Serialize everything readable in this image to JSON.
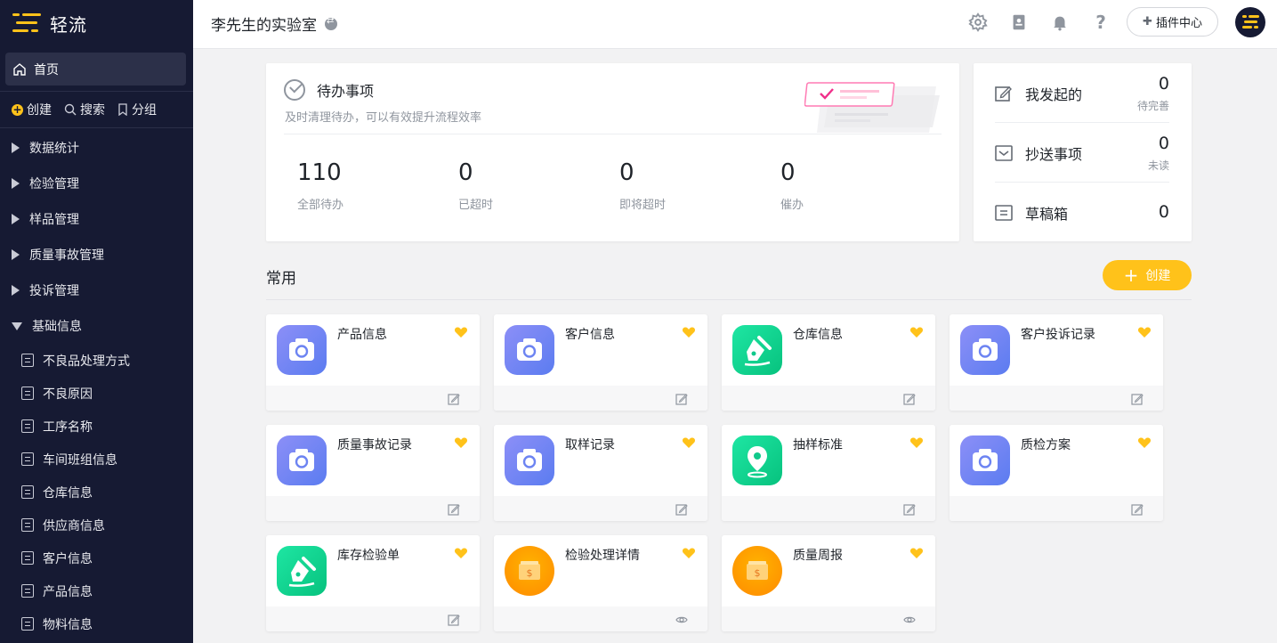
{
  "app": {
    "name": "轻流"
  },
  "sidebar": {
    "home_label": "首页",
    "quick": [
      {
        "label": "创建",
        "icon": "plus-circle-icon"
      },
      {
        "label": "搜索",
        "icon": "search-icon"
      },
      {
        "label": "分组",
        "icon": "bookmark-icon"
      }
    ],
    "groups": [
      {
        "label": "数据统计",
        "expanded": false
      },
      {
        "label": "检验管理",
        "expanded": false
      },
      {
        "label": "样品管理",
        "expanded": false
      },
      {
        "label": "质量事故管理",
        "expanded": false
      },
      {
        "label": "投诉管理",
        "expanded": false
      },
      {
        "label": "基础信息",
        "expanded": true
      }
    ],
    "sub_items": [
      "不良品处理方式",
      "不良原因",
      "工序名称",
      "车间班组信息",
      "仓库信息",
      "供应商信息",
      "客户信息",
      "产品信息",
      "物料信息"
    ]
  },
  "topbar": {
    "workspace": "李先生的实验室",
    "plugin_label": "插件中心",
    "icons": [
      "settings-icon",
      "contacts-icon",
      "bell-icon",
      "help-icon"
    ]
  },
  "todo": {
    "title": "待办事项",
    "subtitle": "及时清理待办，可以有效提升流程效率",
    "stats": [
      {
        "value": "110",
        "label": "全部待办"
      },
      {
        "value": "0",
        "label": "已超时"
      },
      {
        "value": "0",
        "label": "即将超时"
      },
      {
        "value": "0",
        "label": "催办"
      }
    ]
  },
  "side": {
    "rows": [
      {
        "label": "我发起的",
        "value": "0",
        "note": "待完善"
      },
      {
        "label": "抄送事项",
        "value": "0",
        "note": "未读"
      },
      {
        "label": "草稿箱",
        "value": "0",
        "note": ""
      }
    ]
  },
  "common": {
    "title": "常用",
    "create_label": "创建",
    "apps": [
      {
        "name": "产品信息",
        "icon": "camera",
        "action": "edit"
      },
      {
        "name": "客户信息",
        "icon": "camera",
        "action": "edit"
      },
      {
        "name": "仓库信息",
        "icon": "pen",
        "action": "edit"
      },
      {
        "name": "客户投诉记录",
        "icon": "camera",
        "action": "edit"
      },
      {
        "name": "质量事故记录",
        "icon": "camera",
        "action": "edit"
      },
      {
        "name": "取样记录",
        "icon": "camera",
        "action": "edit"
      },
      {
        "name": "抽样标准",
        "icon": "location",
        "action": "edit"
      },
      {
        "name": "质检方案",
        "icon": "camera",
        "action": "edit"
      },
      {
        "name": "库存检验单",
        "icon": "pen",
        "action": "edit"
      },
      {
        "name": "检验处理详情",
        "icon": "coin",
        "action": "view"
      },
      {
        "name": "质量周报",
        "icon": "coin",
        "action": "view"
      }
    ]
  },
  "colors": {
    "sidebar_bg": "#161a33",
    "accent": "#ffc21a",
    "camera_grad": "#5b7cf0",
    "pen_grad": "#07c27e",
    "coin_grad": "#ff8a00"
  }
}
